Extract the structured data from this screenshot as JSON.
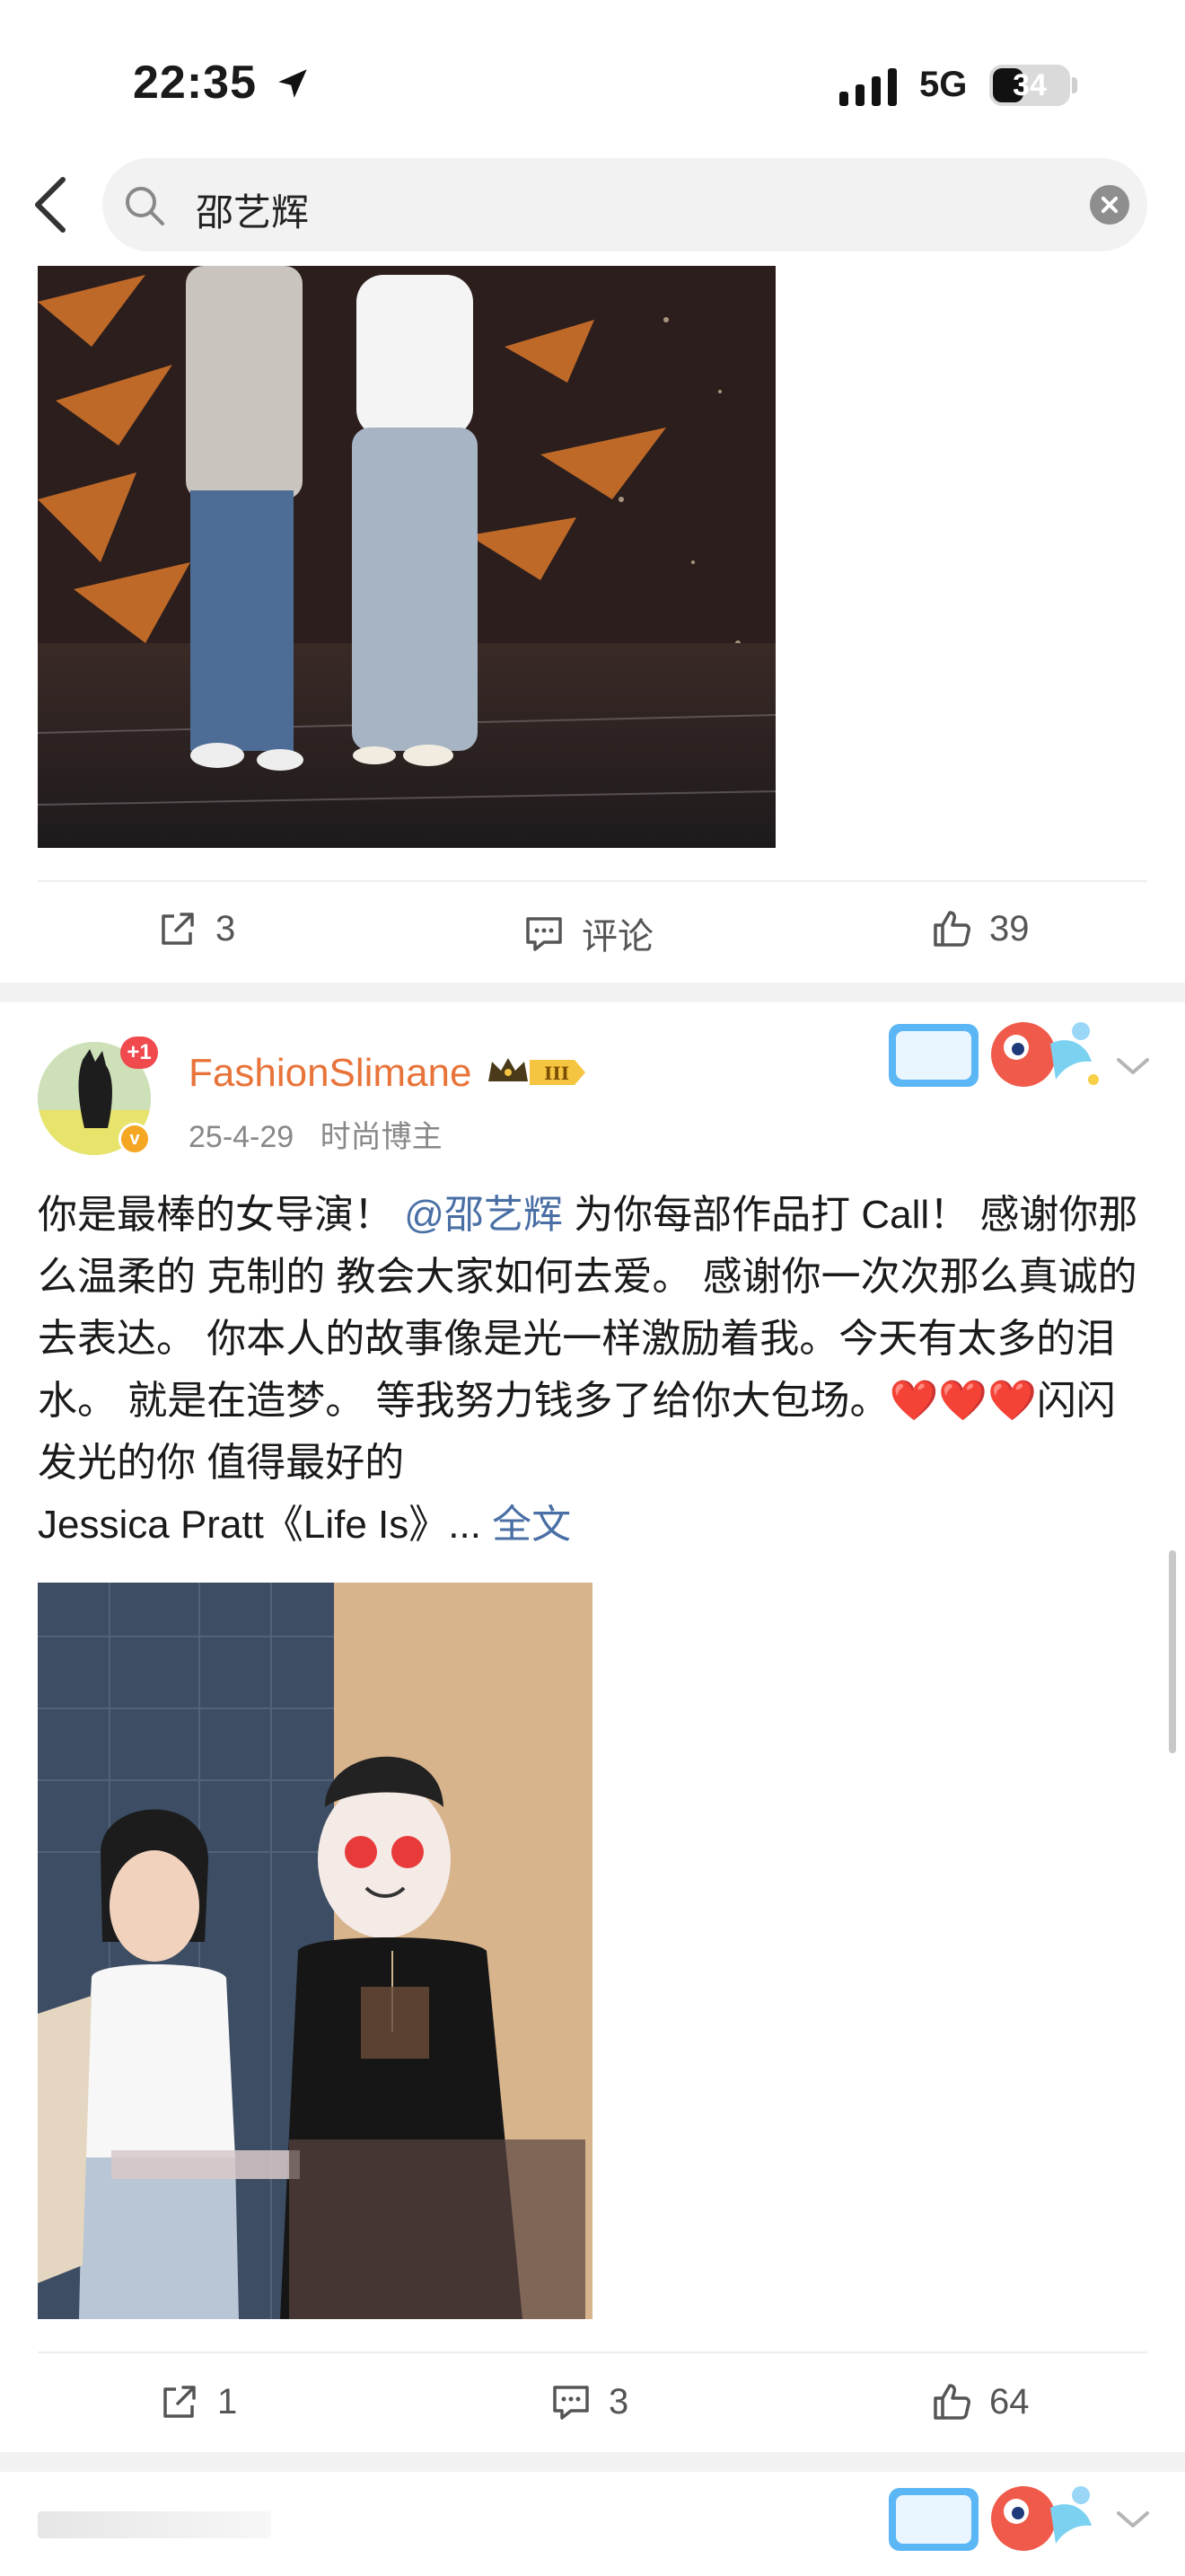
{
  "status_bar": {
    "time": "22:35",
    "network": "5G",
    "battery": "34"
  },
  "search": {
    "query": "邵艺辉"
  },
  "post1": {
    "actions": {
      "share_count": "3",
      "comment_label": "评论",
      "like_count": "39"
    }
  },
  "post2": {
    "username": "FashionSlimane",
    "avatar_badge": "+1",
    "verified_badge": "v",
    "date": "25-4-29",
    "category": "时尚博主",
    "text_before_mention": "你是最棒的女导演！",
    "mention": "@邵艺辉",
    "text_after_mention": "为你每部作品打 Call！ 感谢你那么温柔的 克制的 教会大家如何去爱。 感谢你一次次那么真诚的去表达。 你本人的故事像是光一样激励着我。今天有太多的泪水。 就是在造梦。 等我努力钱多了给你大包场。",
    "hearts": "❤️❤️❤️",
    "text_tail": "闪闪发光的你 值得最好的",
    "song_line": "Jessica Pratt《Life Is》...",
    "more_link": "全文",
    "actions": {
      "share_count": "1",
      "comment_count": "3",
      "like_count": "64"
    }
  },
  "colors": {
    "username": "#e8743a",
    "mention": "#4a6fa5",
    "action_text": "#555555",
    "section_gap": "#f2f2f2"
  }
}
